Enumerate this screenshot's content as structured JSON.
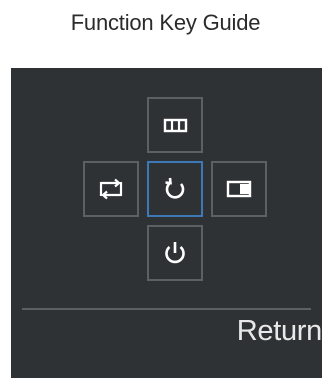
{
  "title": "Function Key Guide",
  "keys": {
    "up": {
      "icon": "menu-icon"
    },
    "left": {
      "icon": "source-switch-icon"
    },
    "center": {
      "icon": "return-arrow-icon",
      "selected": true
    },
    "right": {
      "icon": "picture-in-picture-icon"
    },
    "down": {
      "icon": "power-icon"
    }
  },
  "action_label": "Return",
  "colors": {
    "panel": "#2f3234",
    "key_border": "#5d6063",
    "selected_border": "#3d79b6",
    "icon": "#ffffff",
    "title_text": "#2b2b2b"
  }
}
